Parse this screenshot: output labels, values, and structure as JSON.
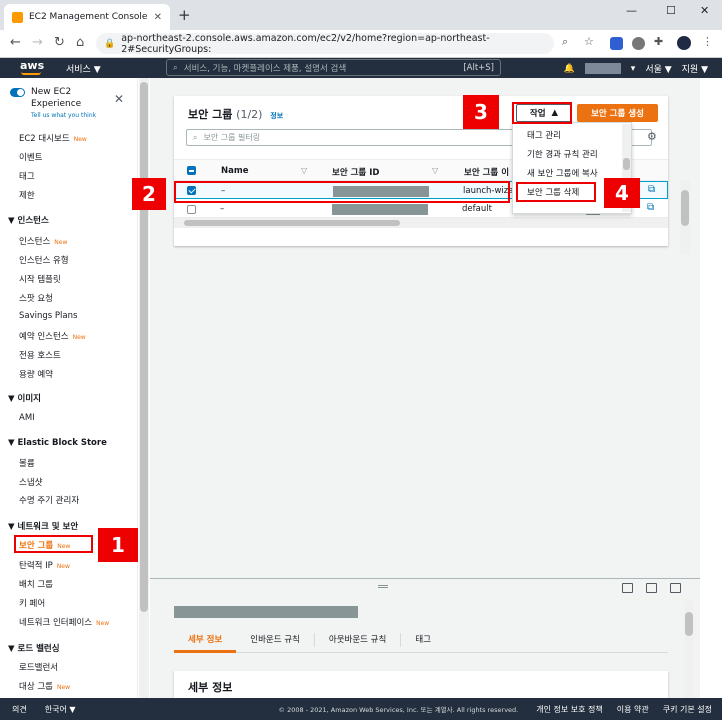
{
  "browser": {
    "tab_title": "EC2 Management Console",
    "new_tab": "+",
    "url": "ap-northeast-2.console.aws.amazon.com/ec2/v2/home?region=ap-northeast-2#SecurityGroups:"
  },
  "aws_header": {
    "logo": "aws",
    "services": "서비스 ▼",
    "search_placeholder": "서비스, 기능, 마켓플레이스 제품, 설명서 검색",
    "search_shortcut": "[Alt+S]",
    "region": "서울 ▼",
    "support": "지원 ▼"
  },
  "sidebar": {
    "new_experience": "New EC2 Experience",
    "tell_us": "Tell us what you think",
    "items": [
      {
        "label": "EC2 대시보드",
        "badge": "New"
      },
      {
        "label": "이벤트",
        "badge": ""
      },
      {
        "label": "태그",
        "badge": ""
      },
      {
        "label": "제한",
        "badge": ""
      }
    ],
    "instances_header": "▼ 인스턴스",
    "instances": [
      {
        "label": "인스턴스",
        "badge": "New"
      },
      {
        "label": "인스턴스 유형",
        "badge": ""
      },
      {
        "label": "시작 템플릿",
        "badge": ""
      },
      {
        "label": "스팟 요청",
        "badge": ""
      },
      {
        "label": "Savings Plans",
        "badge": ""
      },
      {
        "label": "예약 인스턴스",
        "badge": "New"
      },
      {
        "label": "전용 호스트",
        "badge": ""
      },
      {
        "label": "용량 예약",
        "badge": ""
      }
    ],
    "images_header": "▼ 이미지",
    "images": [
      {
        "label": "AMI"
      }
    ],
    "ebs_header": "▼ Elastic Block Store",
    "ebs": [
      {
        "label": "볼륨"
      },
      {
        "label": "스냅샷"
      },
      {
        "label": "수명 주기 관리자"
      }
    ],
    "network_header": "▼ 네트워크 및 보안",
    "network": [
      {
        "label": "보안 그룹",
        "badge": "New"
      },
      {
        "label": "탄력적 IP",
        "badge": "New"
      },
      {
        "label": "배치 그룹",
        "badge": ""
      },
      {
        "label": "키 페어",
        "badge": ""
      },
      {
        "label": "네트워크 인터페이스",
        "badge": "New"
      }
    ],
    "lb_header": "▼ 로드 밸런싱",
    "lb": [
      {
        "label": "로드밸런서",
        "badge": ""
      },
      {
        "label": "대상 그룹",
        "badge": "New"
      }
    ]
  },
  "main": {
    "title": "보안 그룹",
    "count": "(1/2)",
    "info": "정보",
    "filter_placeholder": "보안 그룹 필터링",
    "actions_button": "작업",
    "create_button": "보안 그룹 생성",
    "columns": [
      "Name",
      "보안 그룹 ID",
      "보안 그룹 이"
    ],
    "rows": [
      {
        "name": "–",
        "group_name": "launch-wiza",
        "selected": true
      },
      {
        "name": "–",
        "group_name": "default",
        "selected": false
      }
    ],
    "menu_items": [
      "태그 관리",
      "기한 경과 규칙 관리",
      "새 보안 그룹에 복사",
      "보안 그룹 삭제"
    ]
  },
  "bottom_panel": {
    "tabs": [
      "세부 정보",
      "인바운드 규칙",
      "아웃바운드 규칙",
      "태그"
    ],
    "details_title": "세부 정보"
  },
  "footer": {
    "feedback": "의견",
    "language": "한국어 ▼",
    "copyright": "© 2008 - 2021, Amazon Web Services, Inc. 또는 계열사. All rights reserved.",
    "privacy": "개인 정보 보호 정책",
    "terms": "이용 약관",
    "cookies": "쿠키 기본 설정"
  },
  "annotations": [
    "1",
    "2",
    "3",
    "4"
  ],
  "colors": {
    "accent": "#ec7211",
    "annotation": "#ee0000",
    "aws_dark": "#232f3e",
    "link": "#0073bb"
  }
}
